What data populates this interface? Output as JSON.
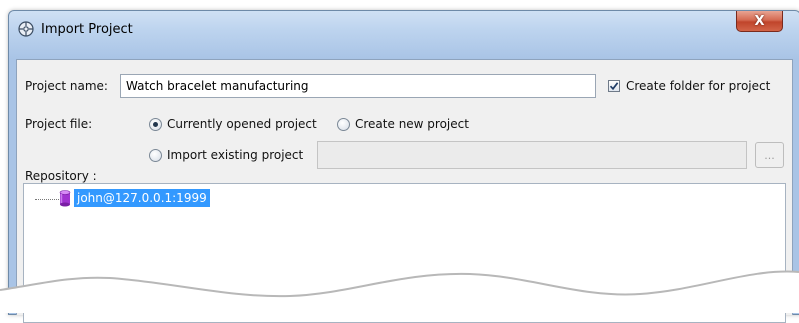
{
  "window": {
    "title": "Import Project",
    "close_label": "X"
  },
  "form": {
    "project_name_label": "Project name:",
    "project_name_value": "Watch bracelet manufacturing",
    "create_folder_label": "Create folder for project",
    "create_folder_checked": true,
    "project_file_label": "Project file:",
    "option_current": "Currently opened project",
    "option_new": "Create new project",
    "option_existing": "Import existing project",
    "selected_option": "Currently opened project",
    "existing_path_value": "",
    "browse_label": "..."
  },
  "repository": {
    "label": "Repository :",
    "nodes": [
      {
        "label": "john@127.0.0.1:1999",
        "icon": "database-icon",
        "selected": true
      }
    ]
  },
  "colors": {
    "selection": "#3399ff",
    "close_button": "#c9503a",
    "database_icon": "#9b2fc9"
  }
}
